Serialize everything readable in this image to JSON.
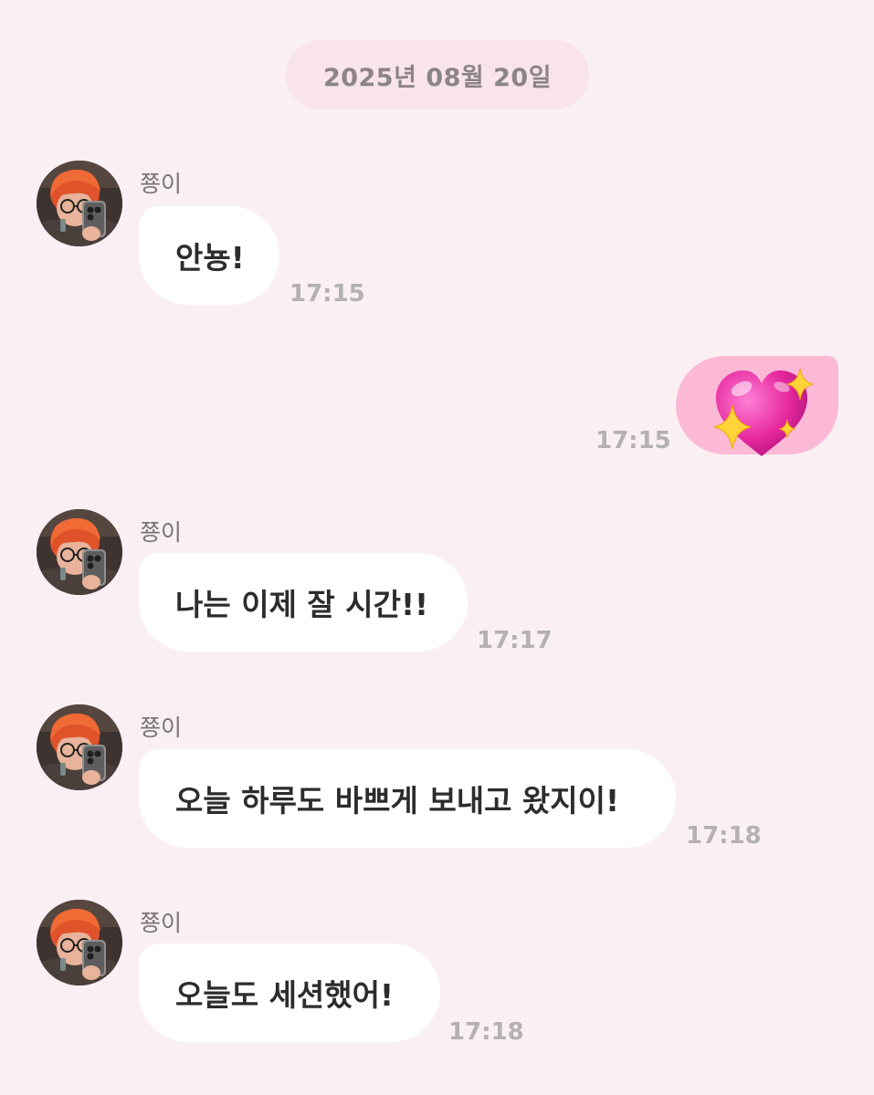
{
  "date_divider": "2025년 08월 20일",
  "messages": [
    {
      "sender": "쭁이",
      "text": "안뇽!",
      "time": "17:15"
    },
    {
      "mine": true,
      "content_icon": "sparkling-heart-emoji",
      "time": "17:15"
    },
    {
      "sender": "쭁이",
      "text": "나는 이제 잘 시간!!",
      "time": "17:17"
    },
    {
      "sender": "쭁이",
      "text": "오늘 하루도 바쁘게 보내고 왔지이!",
      "time": "17:18"
    },
    {
      "sender": "쭁이",
      "text": "오늘도 세션했어!",
      "time": "17:18"
    }
  ],
  "colors": {
    "background": "#faf0f3",
    "date_pill": "#f8e4ea",
    "incoming_bubble": "#ffffff",
    "outgoing_bubble": "#fbb9d6",
    "timestamp": "#b4b0b4"
  }
}
